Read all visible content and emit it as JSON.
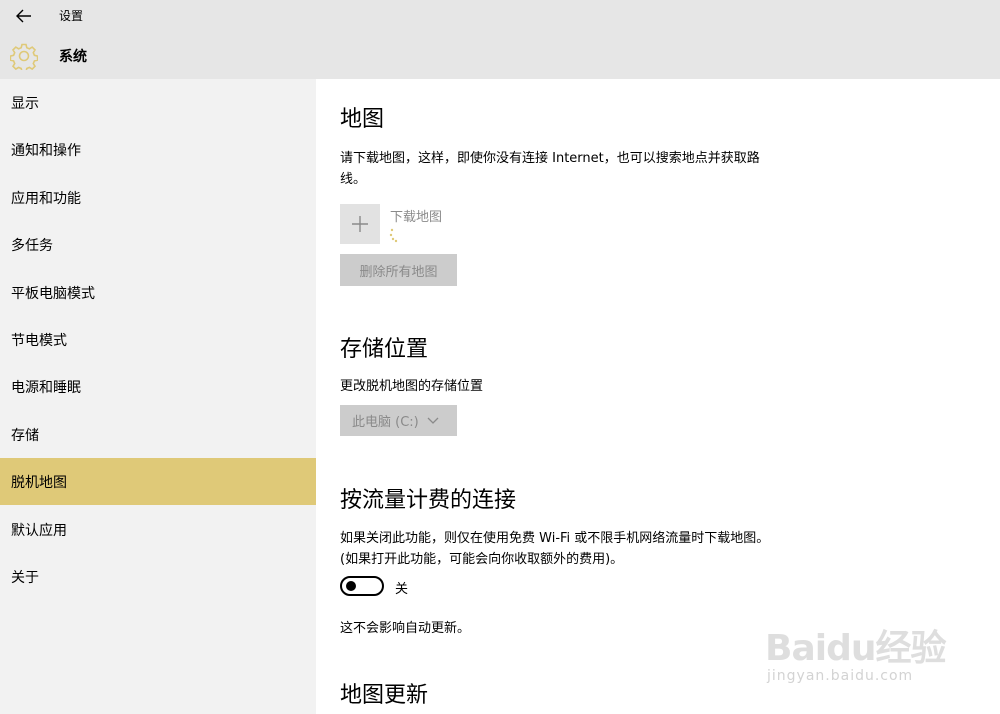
{
  "header": {
    "app_title": "设置",
    "section_title": "系统",
    "back_icon": "back-arrow-icon",
    "section_icon": "gear-icon",
    "accent_color": "#dfc978"
  },
  "sidebar": {
    "items": [
      {
        "label": "显示"
      },
      {
        "label": "通知和操作"
      },
      {
        "label": "应用和功能"
      },
      {
        "label": "多任务"
      },
      {
        "label": "平板电脑模式"
      },
      {
        "label": "节电模式"
      },
      {
        "label": "电源和睡眠"
      },
      {
        "label": "存储"
      },
      {
        "label": "脱机地图"
      },
      {
        "label": "默认应用"
      },
      {
        "label": "关于"
      }
    ],
    "active_item": "脱机地图"
  },
  "main": {
    "maps": {
      "heading": "地图",
      "description": "请下载地图，这样，即使你没有连接 Internet，也可以搜索地点并获取路线。",
      "add_label": "下载地图",
      "delete_all_label": "删除所有地图"
    },
    "storage": {
      "heading": "存储位置",
      "description": "更改脱机地图的存储位置",
      "selected": "此电脑 (C:)"
    },
    "metered": {
      "heading": "按流量计费的连接",
      "description": "如果关闭此功能，则仅在使用免费 Wi-Fi 或不限手机网络流量时下载地图。(如果打开此功能，可能会向你收取额外的费用)。",
      "toggle_state": "关",
      "note": "这不会影响自动更新。"
    },
    "updates": {
      "heading": "地图更新"
    }
  },
  "watermark": {
    "brand": "Baidu经验",
    "url": "jingyan.baidu.com"
  }
}
